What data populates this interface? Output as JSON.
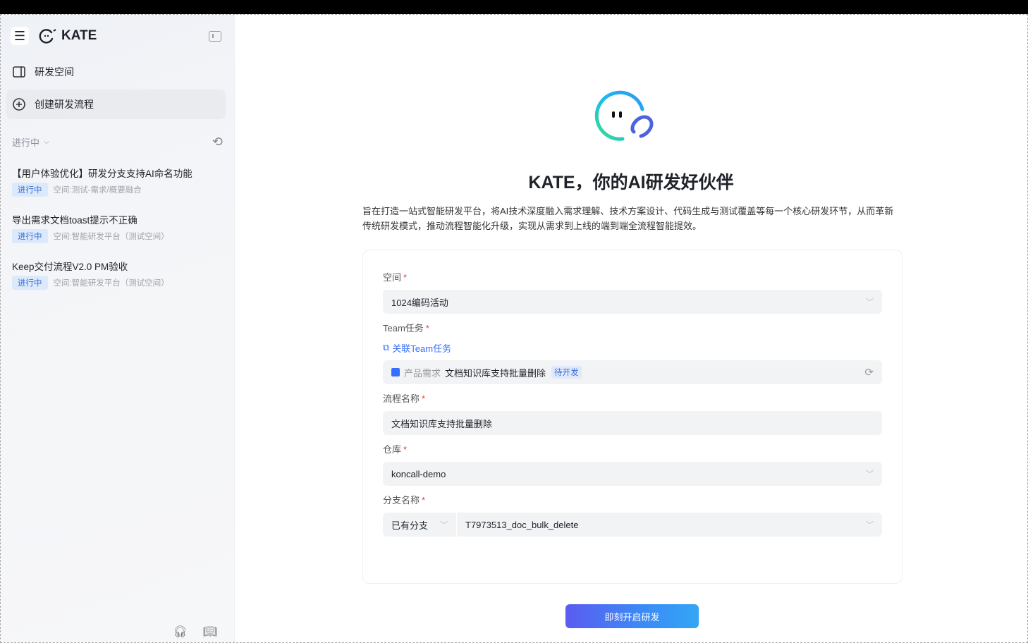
{
  "app": {
    "name": "KATE"
  },
  "sidebar": {
    "nav": [
      {
        "label": "研发空间",
        "icon": "workspace-icon"
      },
      {
        "label": "创建研发流程",
        "icon": "plus-circle-icon"
      }
    ],
    "section": {
      "label": "进行中"
    },
    "items": [
      {
        "title": "【用户体验优化】研发分支支持AI命名功能",
        "status": "进行中",
        "space": "空间:测试-需求/概要融合"
      },
      {
        "title": "导出需求文档toast提示不正确",
        "status": "进行中",
        "space": "空间:智能研发平台（测试空间）"
      },
      {
        "title": "Keep交付流程V2.0 PM验收",
        "status": "进行中",
        "space": "空间:智能研发平台（测试空间）"
      }
    ]
  },
  "main": {
    "title": "KATE，你的AI研发好伙伴",
    "description": "旨在打造一站式智能研发平台，将AI技术深度融入需求理解、技术方案设计、代码生成与测试覆盖等每一个核心研发环节，从而革新传统研发模式，推动流程智能化升级，实现从需求到上线的端到端全流程智能提效。",
    "form": {
      "space": {
        "label": "空间",
        "value": "1024编码活动"
      },
      "team_task": {
        "label": "Team任务",
        "link": "关联Team任务",
        "type": "产品需求",
        "name": "文档知识库支持批量删除",
        "status": "待开发"
      },
      "flow_name": {
        "label": "流程名称",
        "value": "文档知识库支持批量删除"
      },
      "repo": {
        "label": "仓库",
        "value": "koncall-demo"
      },
      "branch": {
        "label": "分支名称",
        "mode": "已有分支",
        "value": "T7973513_doc_bulk_delete"
      }
    },
    "submit": "即刻开启研发"
  }
}
